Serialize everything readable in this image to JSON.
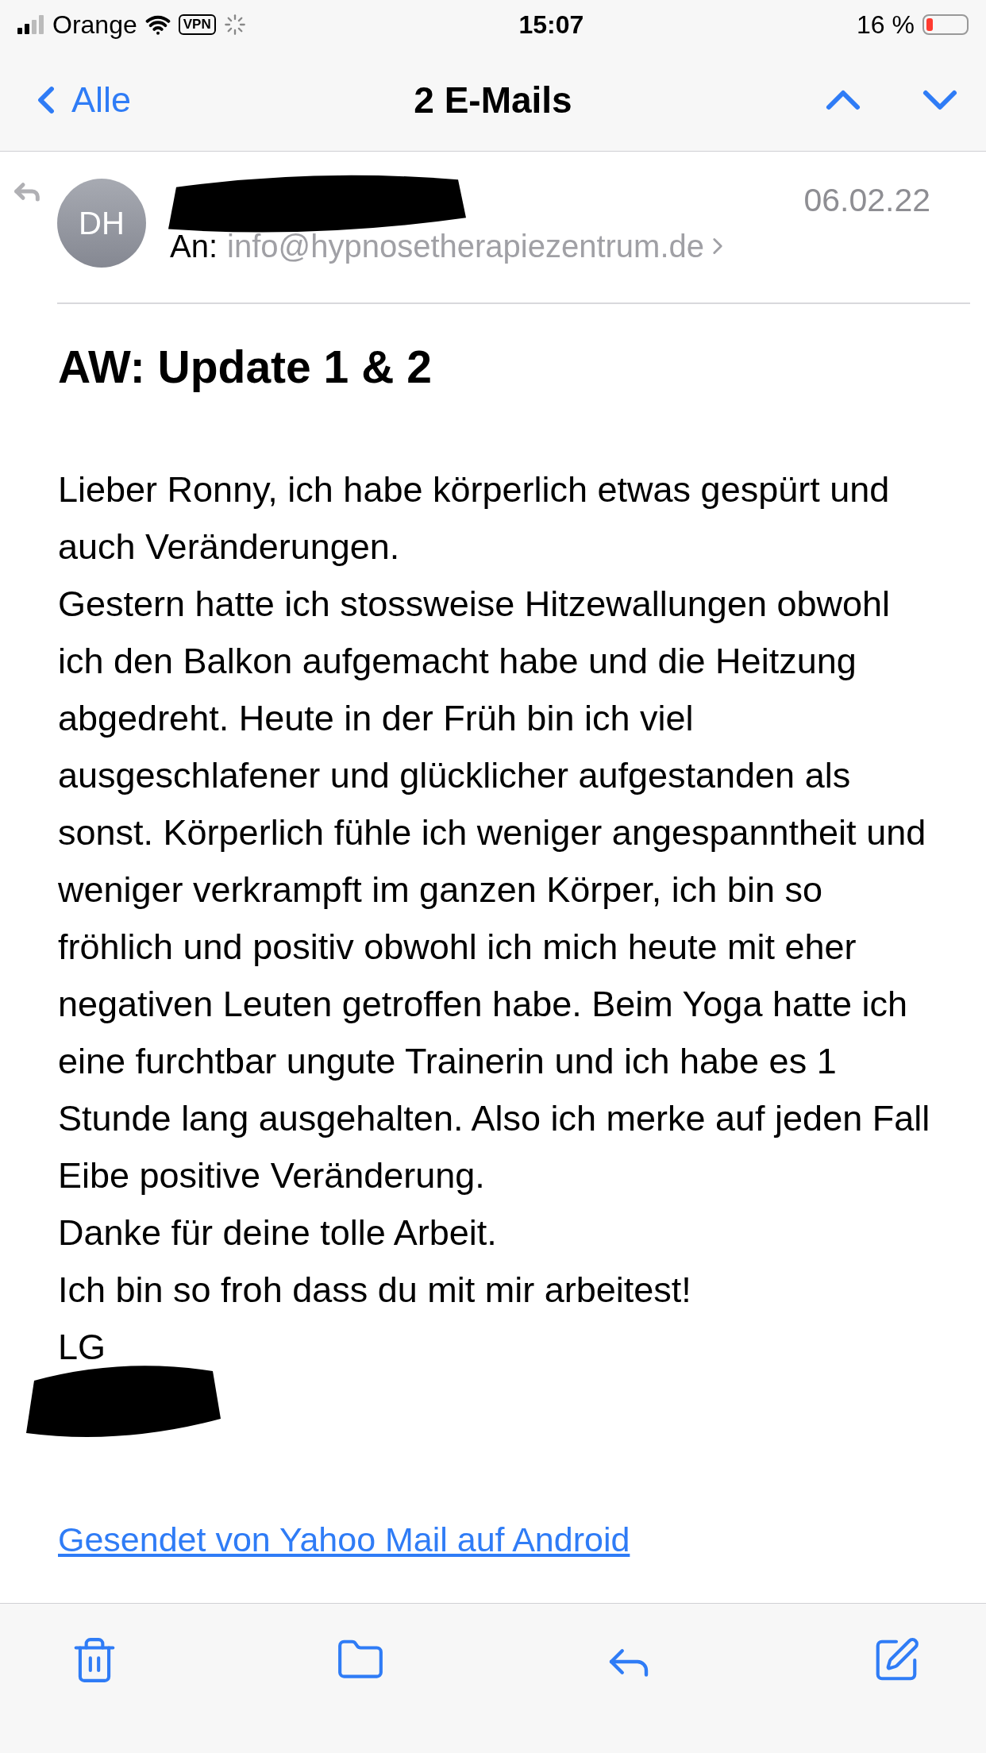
{
  "status_bar": {
    "carrier": "Orange",
    "vpn": "VPN",
    "time": "15:07",
    "battery": "16 %"
  },
  "nav_bar": {
    "back": "Alle",
    "title": "2 E-Mails"
  },
  "message": {
    "avatar": "DH",
    "date": "06.02.22",
    "to_label": "An:",
    "to": "info@hypnosetherapiezentrum.de",
    "subject": "AW: Update 1 & 2",
    "body": [
      "Lieber Ronny, ich habe körperlich etwas gespürt und auch Veränderungen.",
      "Gestern hatte ich stossweise Hitzewallungen obwohl ich den Balkon aufgemacht habe und die Heitzung abgedreht. Heute in der Früh bin ich viel ausgeschlafener und glücklicher aufgestanden als sonst. Körperlich fühle ich weniger angespanntheit und weniger verkrampft im ganzen Körper, ich bin so fröhlich und positiv obwohl ich mich heute mit eher negativen Leuten getroffen habe. Beim Yoga hatte ich eine furchtbar ungute Trainerin und ich habe es 1 Stunde lang ausgehalten. Also ich merke auf jeden Fall Eibe positive Veränderung.",
      "Danke für deine tolle Arbeit.",
      "Ich bin so froh dass du mit mir arbeitest!",
      "LG"
    ],
    "link": "Gesendet von Yahoo Mail auf Android"
  }
}
